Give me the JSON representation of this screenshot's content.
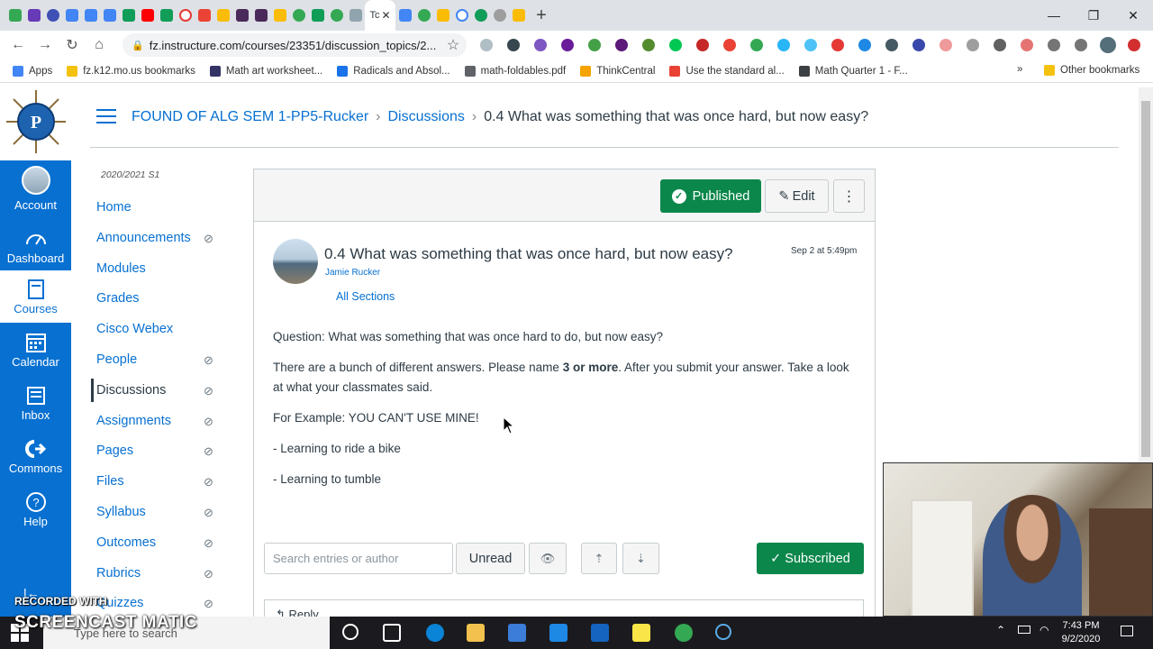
{
  "browser": {
    "active_tab_short": "Tc",
    "url": "fz.instructure.com/courses/23351/discussion_topics/2...",
    "bookmarks": [
      {
        "label": "Apps",
        "color": "#4285f4"
      },
      {
        "label": "fz.k12.mo.us bookmarks",
        "color": "#f4c20d"
      },
      {
        "label": "Math art worksheet...",
        "color": "#333366"
      },
      {
        "label": "Radicals and Absol...",
        "color": "#1a73e8"
      },
      {
        "label": "math-foldables.pdf",
        "color": "#5f6368"
      },
      {
        "label": "ThinkCentral",
        "color": "#f4a300"
      },
      {
        "label": "Use the standard al...",
        "color": "#e94235"
      },
      {
        "label": "Math Quarter 1 - F...",
        "color": "#3c4043"
      }
    ],
    "overflow": "»",
    "other_bookmarks": "Other bookmarks"
  },
  "global_nav": {
    "items": [
      {
        "label": "Account",
        "icon": "avatar"
      },
      {
        "label": "Dashboard",
        "icon": "dashboard-icon"
      },
      {
        "label": "Courses",
        "icon": "courses-icon"
      },
      {
        "label": "Calendar",
        "icon": "calendar-icon"
      },
      {
        "label": "Inbox",
        "icon": "inbox-icon"
      },
      {
        "label": "Commons",
        "icon": "commons-icon"
      },
      {
        "label": "Help",
        "icon": "help-icon"
      }
    ]
  },
  "breadcrumb": {
    "course": "FOUND OF ALG SEM 1-PP5-Rucker",
    "section": "Discussions",
    "current": "0.4 What was something that was once hard, but now easy?"
  },
  "course_nav": {
    "term": "2020/2021 S1",
    "items": [
      {
        "label": "Home",
        "hidden": false
      },
      {
        "label": "Announcements",
        "hidden": true
      },
      {
        "label": "Modules",
        "hidden": false
      },
      {
        "label": "Grades",
        "hidden": false
      },
      {
        "label": "Cisco Webex",
        "hidden": false
      },
      {
        "label": "People",
        "hidden": true
      },
      {
        "label": "Discussions",
        "hidden": true
      },
      {
        "label": "Assignments",
        "hidden": true
      },
      {
        "label": "Pages",
        "hidden": true
      },
      {
        "label": "Files",
        "hidden": true
      },
      {
        "label": "Syllabus",
        "hidden": true
      },
      {
        "label": "Outcomes",
        "hidden": true
      },
      {
        "label": "Rubrics",
        "hidden": true
      },
      {
        "label": "Quizzes",
        "hidden": true
      }
    ],
    "current": "Discussions"
  },
  "discussion": {
    "published_label": "Published",
    "edit_label": "Edit",
    "more_label": "⋮",
    "title": "0.4 What was something that was once hard, but now easy?",
    "author": "Jamie Rucker",
    "date": "Sep 2 at 5:49pm",
    "sections": "All Sections",
    "question": "Question: What was something that was once hard to do, but now easy?",
    "instr_before": "There are a bunch of different answers. Please name ",
    "instr_bold": "3 or more",
    "instr_after": ". After you submit your answer. Take a look at what your classmates said.",
    "example": "For Example: YOU CAN'T USE MINE!",
    "item1": "- Learning to ride a bike",
    "item2": "- Learning to tumble"
  },
  "toolbar": {
    "search_placeholder": "Search entries or author",
    "unread_label": "Unread",
    "subscribed_label": "Subscribed",
    "reply_label": "Reply"
  },
  "watermark": {
    "line1": "RECORDED WITH",
    "line2": "SCREENCAST  MATIC"
  },
  "taskbar": {
    "search_placeholder": "Type here to search",
    "time": "7:43 PM",
    "date": "9/2/2020"
  },
  "colors": {
    "canvas_blue": "#0770d1",
    "published_green": "#0b874b"
  }
}
